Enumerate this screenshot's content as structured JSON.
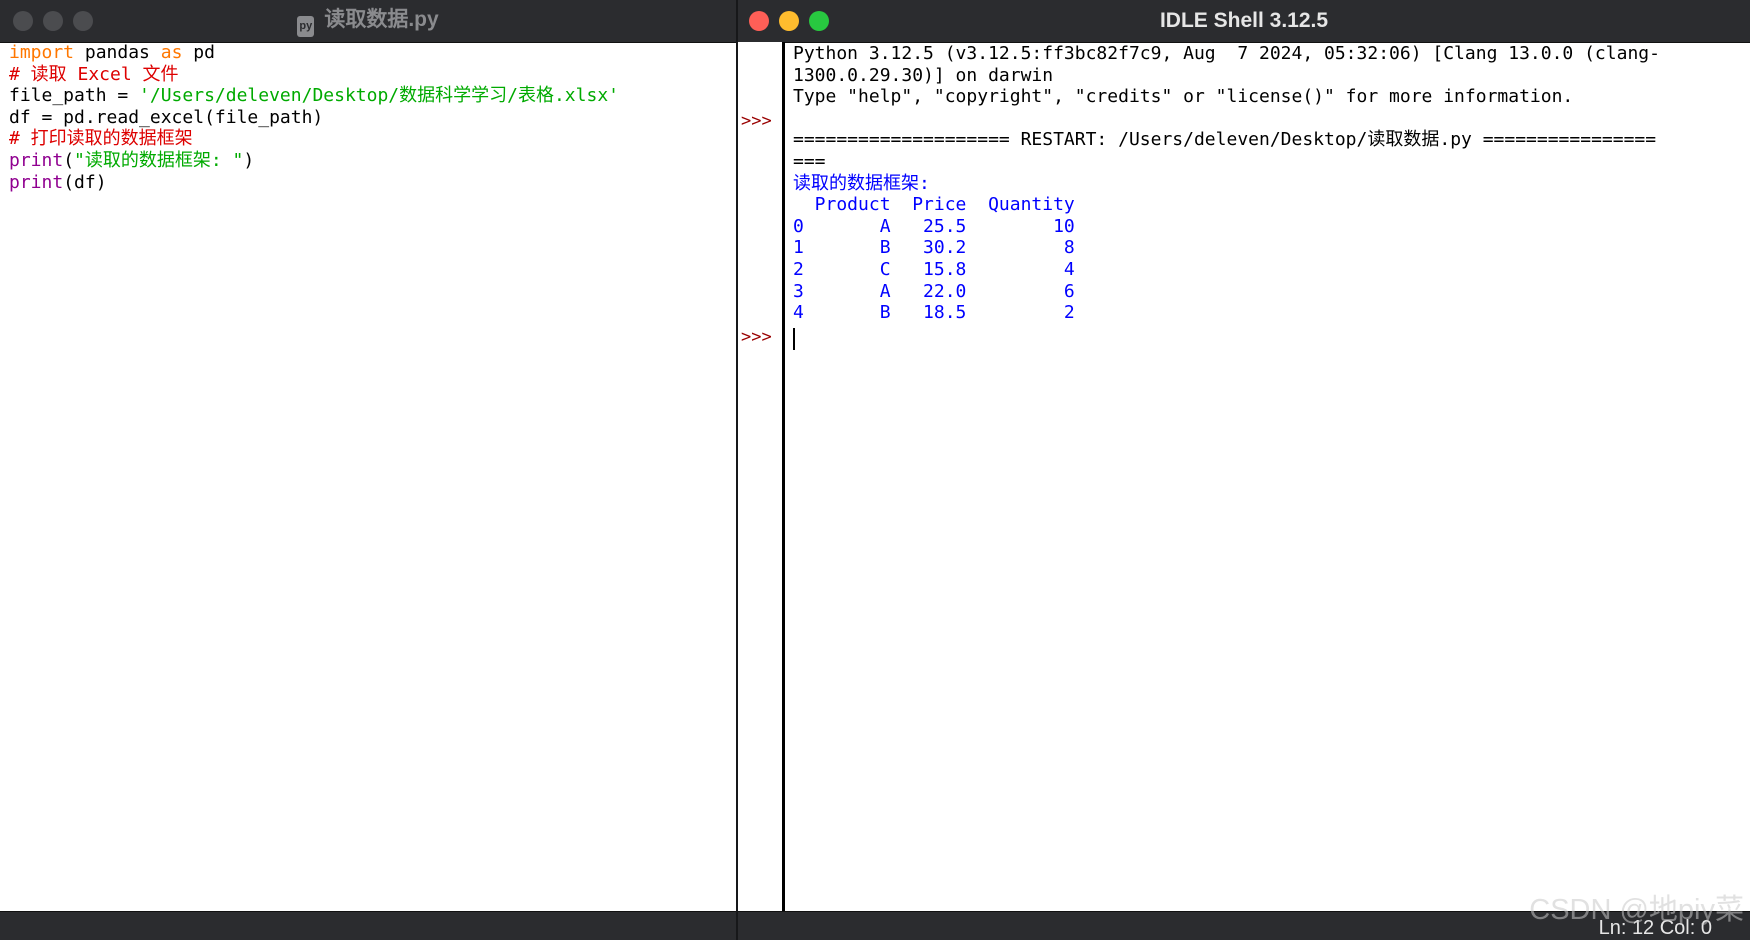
{
  "editor": {
    "title": "读取数据.py",
    "lines": [
      [
        {
          "c": "kw",
          "t": "import"
        },
        {
          "c": "",
          "t": " pandas "
        },
        {
          "c": "kw",
          "t": "as"
        },
        {
          "c": "",
          "t": " pd"
        }
      ],
      [
        {
          "c": "cmt",
          "t": "# 读取 Excel 文件"
        }
      ],
      [
        {
          "c": "",
          "t": "file_path = "
        },
        {
          "c": "str",
          "t": "'/Users/deleven/Desktop/数据科学学习/表格.xlsx'"
        }
      ],
      [
        {
          "c": "",
          "t": "df = pd.read_excel(file_path)"
        }
      ],
      [
        {
          "c": "cmt",
          "t": "# 打印读取的数据框架"
        }
      ],
      [
        {
          "c": "bi",
          "t": "print"
        },
        {
          "c": "",
          "t": "("
        },
        {
          "c": "str",
          "t": "\"读取的数据框架: \""
        },
        {
          "c": "",
          "t": ")"
        }
      ],
      [
        {
          "c": "bi",
          "t": "print"
        },
        {
          "c": "",
          "t": "(df)"
        }
      ]
    ]
  },
  "shell": {
    "title": "IDLE Shell 3.12.5",
    "prompt": ">>>",
    "lines": [
      {
        "c": "",
        "t": "Python 3.12.5 (v3.12.5:ff3bc82f7c9, Aug  7 2024, 05:32:06) [Clang 13.0.0 (clang-"
      },
      {
        "c": "",
        "t": "1300.0.29.30)] on darwin"
      },
      {
        "c": "",
        "t": "Type \"help\", \"copyright\", \"credits\" or \"license()\" for more information."
      },
      {
        "c": "",
        "t": ""
      },
      {
        "c": "",
        "t": "==================== RESTART: /Users/deleven/Desktop/读取数据.py ================"
      },
      {
        "c": "",
        "t": "==="
      },
      {
        "c": "out",
        "t": "读取的数据框架:"
      },
      {
        "c": "out",
        "t": "  Product  Price  Quantity"
      },
      {
        "c": "out",
        "t": "0       A   25.5        10"
      },
      {
        "c": "out",
        "t": "1       B   30.2         8"
      },
      {
        "c": "out",
        "t": "2       C   15.8         4"
      },
      {
        "c": "out",
        "t": "3       A   22.0         6"
      },
      {
        "c": "out",
        "t": "4       B   18.5         2"
      }
    ],
    "status": "Ln: 12  Col: 0"
  },
  "watermark": "CSDN @地piy菜"
}
